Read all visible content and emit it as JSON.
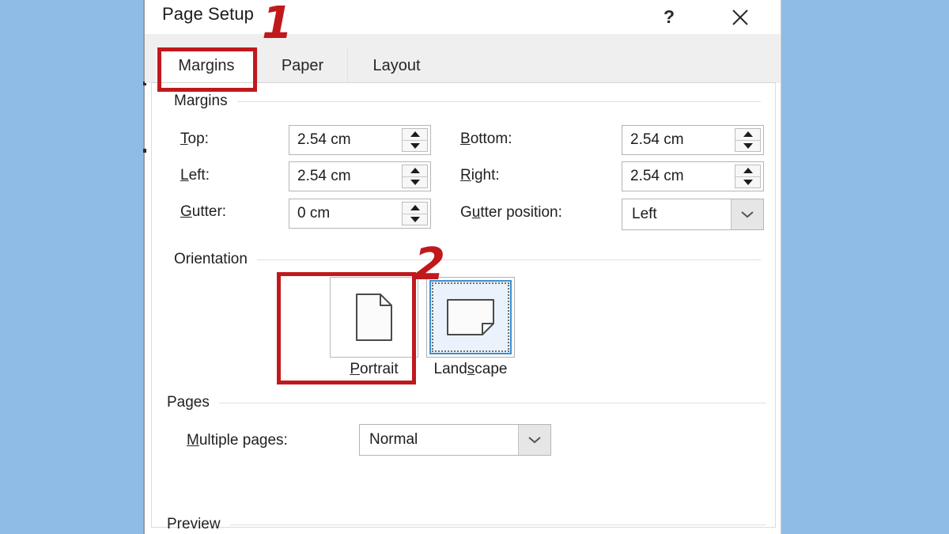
{
  "window": {
    "title": "Page Setup",
    "help_icon": "?",
    "close_icon": "close-icon",
    "background_color": "#8fbce6"
  },
  "tabs": [
    {
      "label": "Margins",
      "active": true
    },
    {
      "label": "Paper",
      "active": false
    },
    {
      "label": "Layout",
      "active": false
    }
  ],
  "groups": {
    "margins": {
      "title": "Margins",
      "fields": [
        {
          "label": "Top:",
          "accel": "T",
          "value": "2.54 cm",
          "type": "spinbox"
        },
        {
          "label": "Left:",
          "accel": "L",
          "value": "2.54 cm",
          "type": "spinbox"
        },
        {
          "label": "Gutter:",
          "accel": "G",
          "value": "0 cm",
          "type": "spinbox"
        },
        {
          "label": "Bottom:",
          "accel": "B",
          "value": "2.54 cm",
          "type": "spinbox"
        },
        {
          "label": "Right:",
          "accel": "R",
          "value": "2.54 cm",
          "type": "spinbox"
        },
        {
          "label": "Gutter position:",
          "accel": "u",
          "value": "Left",
          "type": "combobox"
        }
      ]
    },
    "orientation": {
      "title": "Orientation",
      "options": [
        {
          "label": "Portrait",
          "accel": "P",
          "selected": false
        },
        {
          "label": "Landscape",
          "accel": "s",
          "selected": true
        }
      ]
    },
    "pages": {
      "title": "Pages",
      "multiple_pages_label": "Multiple pages:",
      "multiple_pages_accel": "M",
      "multiple_pages_value": "Normal"
    },
    "preview": {
      "title": "Preview"
    }
  },
  "annotations": [
    {
      "number": "1",
      "target": "margins-tab",
      "color": "#c0191c"
    },
    {
      "number": "2",
      "target": "landscape-orientation",
      "color": "#c0191c"
    }
  ],
  "labels": {
    "top": "Top:",
    "left": "Left:",
    "gutter": "Gutter:",
    "bottom": "Bottom:",
    "right": "Right:",
    "gutter_position": "Gutter position:",
    "multiple_pages": "Multiple pages:"
  },
  "values": {
    "top": "2.54 cm",
    "left": "2.54 cm",
    "gutter": "0 cm",
    "bottom": "2.54 cm",
    "right": "2.54 cm",
    "gutter_position": "Left",
    "multiple_pages": "Normal"
  }
}
